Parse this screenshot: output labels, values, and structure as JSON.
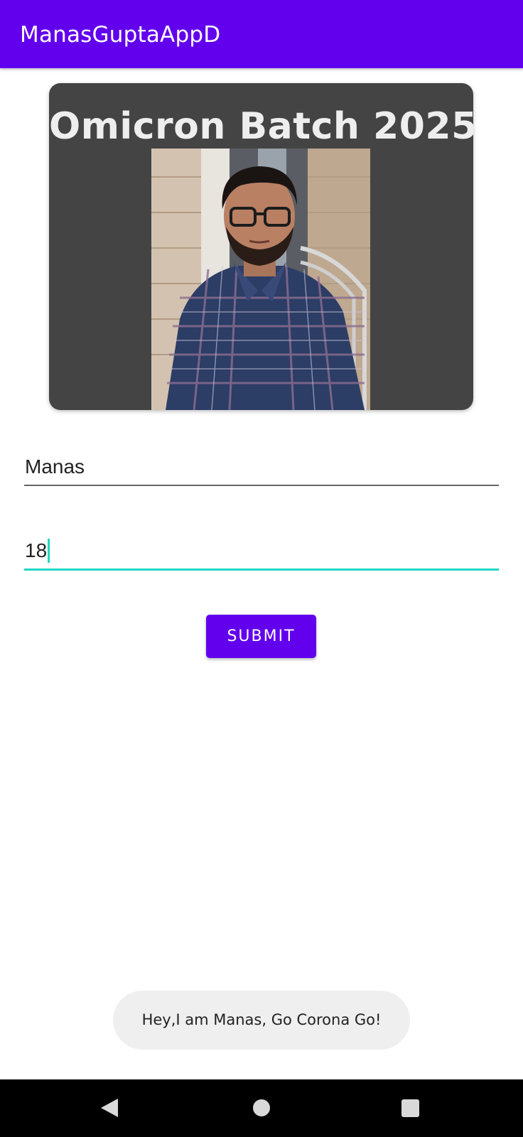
{
  "app_bar": {
    "title": "ManasGuptaAppD",
    "color": "#6200EE"
  },
  "card": {
    "title": "Omicron Batch 2025",
    "background": "#444444",
    "photo": "portrait-photo"
  },
  "form": {
    "name_value": "Manas",
    "age_value": "18",
    "focus_color": "#1ED7C6"
  },
  "submit_button": {
    "label": "SUBMIT",
    "color": "#6200EE"
  },
  "toast": {
    "message": "Hey,I am Manas, Go Corona Go!"
  },
  "nav_bar": {
    "icons": [
      "back-icon",
      "home-icon",
      "recents-icon"
    ]
  }
}
